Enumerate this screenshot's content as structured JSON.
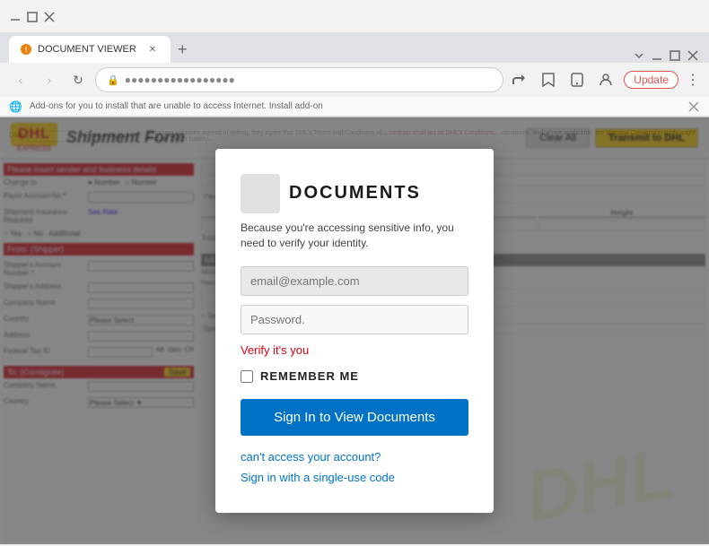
{
  "browser": {
    "tab_title": "DOCUMENT VIEWER",
    "new_tab_label": "+",
    "address_url": "●●●●●●●●●●●●●●●●●",
    "update_btn": "Update",
    "info_bar_text": "Add-ons for you to install that are unable to access Internet. Install add-on"
  },
  "nav": {
    "back": "‹",
    "forward": "›",
    "refresh": "↻",
    "back_disabled": true,
    "forward_disabled": true
  },
  "dhl": {
    "logo": "DHL",
    "logo_sub": "EXPRESS",
    "form_title": "Shipment Form",
    "btn_clear": "Clear All",
    "btn_transmit": "Transmit to DHL",
    "section1": "Please insert sender and business details",
    "fields": [
      {
        "label": "Change To",
        "placeholder": ""
      },
      {
        "label": "Payor Account No",
        "placeholder": ""
      },
      {
        "label": "Shipment Insurance Required",
        "placeholder": ""
      },
      {
        "label": "Yes",
        "placeholder": ""
      },
      {
        "label": "From: (Shipper)",
        "placeholder": ""
      },
      {
        "label": "Shipper's Account Number",
        "placeholder": ""
      },
      {
        "label": "Shipper's Address",
        "placeholder": ""
      },
      {
        "label": "Company Name",
        "placeholder": ""
      },
      {
        "label": "Country",
        "placeholder": "Please Select"
      },
      {
        "label": "Address",
        "placeholder": ""
      },
      {
        "label": "Federal Tax ID",
        "placeholder": ""
      }
    ],
    "section2": "To: (Consignee)",
    "watermark": "DHL"
  },
  "modal": {
    "title": "DOCUMENTS",
    "subtitle": "Because you're accessing sensitive info, you need to verify your identity.",
    "email_placeholder": "email@example.com",
    "password_placeholder": "Password.",
    "verify_link": "Verify it's you",
    "remember_label": "REMEMBER ME",
    "sign_in_btn": "Sign In to View Documents",
    "cant_access": "can't access your account?",
    "single_use": "Sign in with a single-use code"
  }
}
